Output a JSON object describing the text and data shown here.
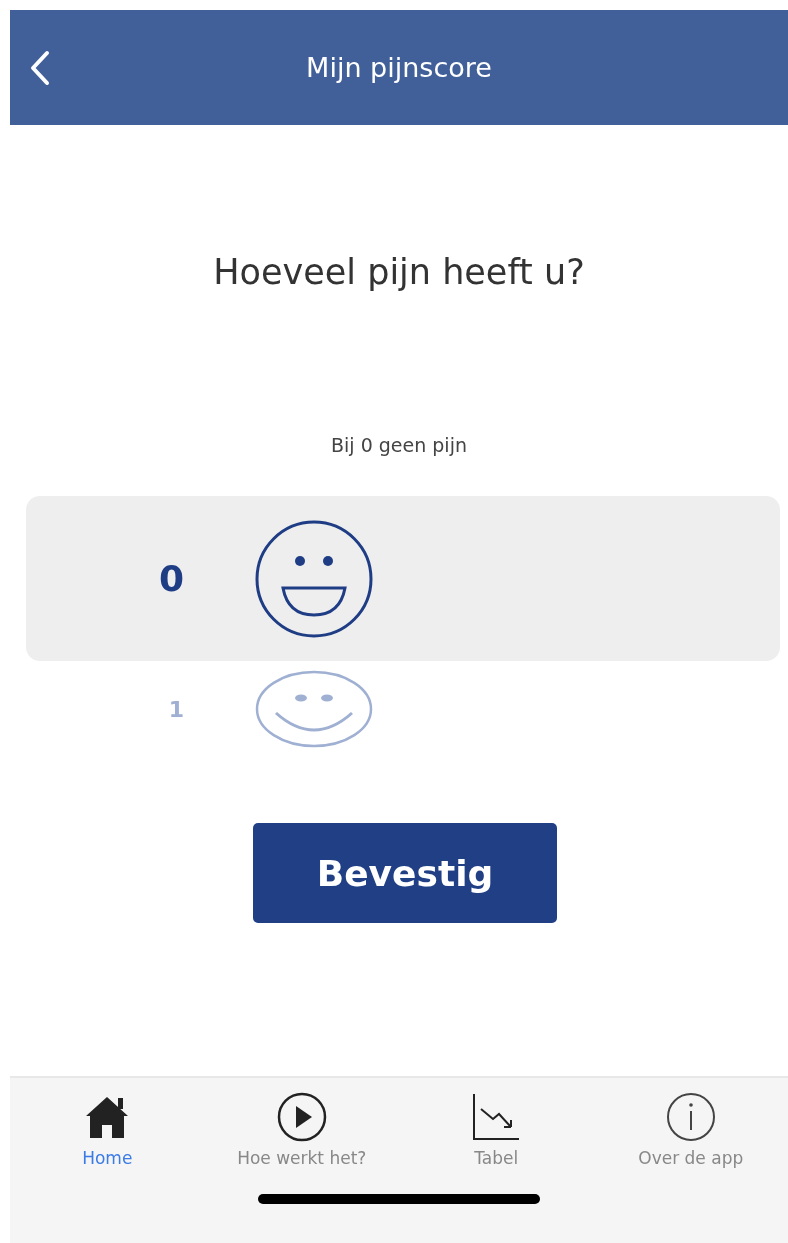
{
  "header": {
    "title": "Mijn pijnscore"
  },
  "question": "Hoeveel pijn heeft u?",
  "hint": "Bij 0 geen pijn",
  "options": [
    {
      "value": "0",
      "kind": "grin",
      "selected": true
    },
    {
      "value": "1",
      "kind": "smile",
      "selected": false
    }
  ],
  "confirm_button": "Bevestig",
  "tabs": [
    {
      "label": "Home",
      "kind": "home",
      "selected": true
    },
    {
      "label": "Hoe werkt het?",
      "kind": "play",
      "selected": false
    },
    {
      "label": "Tabel",
      "kind": "chart",
      "selected": false
    },
    {
      "label": "Over de app",
      "kind": "info",
      "selected": false
    }
  ]
}
